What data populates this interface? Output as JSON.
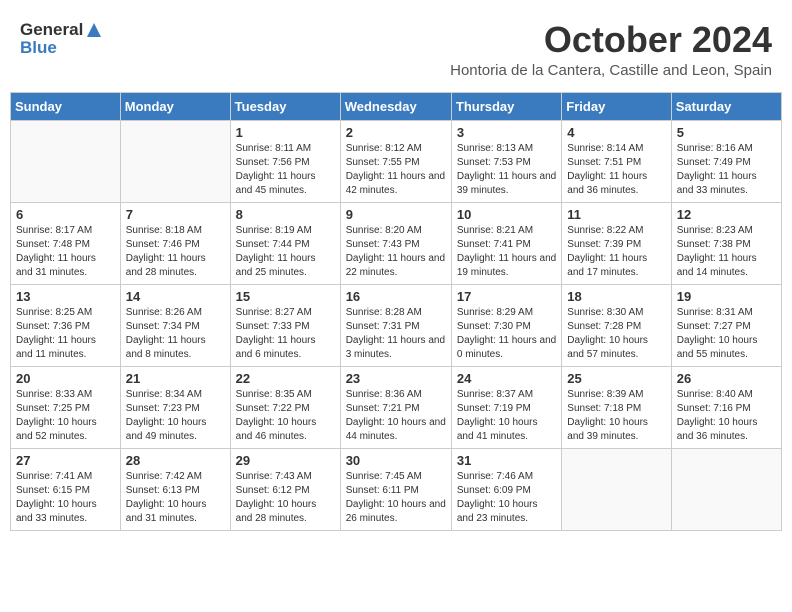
{
  "logo": {
    "general": "General",
    "blue": "Blue"
  },
  "title": "October 2024",
  "location": "Hontoria de la Cantera, Castille and Leon, Spain",
  "weekdays": [
    "Sunday",
    "Monday",
    "Tuesday",
    "Wednesday",
    "Thursday",
    "Friday",
    "Saturday"
  ],
  "weeks": [
    [
      {
        "day": "",
        "info": ""
      },
      {
        "day": "",
        "info": ""
      },
      {
        "day": "1",
        "info": "Sunrise: 8:11 AM\nSunset: 7:56 PM\nDaylight: 11 hours and 45 minutes."
      },
      {
        "day": "2",
        "info": "Sunrise: 8:12 AM\nSunset: 7:55 PM\nDaylight: 11 hours and 42 minutes."
      },
      {
        "day": "3",
        "info": "Sunrise: 8:13 AM\nSunset: 7:53 PM\nDaylight: 11 hours and 39 minutes."
      },
      {
        "day": "4",
        "info": "Sunrise: 8:14 AM\nSunset: 7:51 PM\nDaylight: 11 hours and 36 minutes."
      },
      {
        "day": "5",
        "info": "Sunrise: 8:16 AM\nSunset: 7:49 PM\nDaylight: 11 hours and 33 minutes."
      }
    ],
    [
      {
        "day": "6",
        "info": "Sunrise: 8:17 AM\nSunset: 7:48 PM\nDaylight: 11 hours and 31 minutes."
      },
      {
        "day": "7",
        "info": "Sunrise: 8:18 AM\nSunset: 7:46 PM\nDaylight: 11 hours and 28 minutes."
      },
      {
        "day": "8",
        "info": "Sunrise: 8:19 AM\nSunset: 7:44 PM\nDaylight: 11 hours and 25 minutes."
      },
      {
        "day": "9",
        "info": "Sunrise: 8:20 AM\nSunset: 7:43 PM\nDaylight: 11 hours and 22 minutes."
      },
      {
        "day": "10",
        "info": "Sunrise: 8:21 AM\nSunset: 7:41 PM\nDaylight: 11 hours and 19 minutes."
      },
      {
        "day": "11",
        "info": "Sunrise: 8:22 AM\nSunset: 7:39 PM\nDaylight: 11 hours and 17 minutes."
      },
      {
        "day": "12",
        "info": "Sunrise: 8:23 AM\nSunset: 7:38 PM\nDaylight: 11 hours and 14 minutes."
      }
    ],
    [
      {
        "day": "13",
        "info": "Sunrise: 8:25 AM\nSunset: 7:36 PM\nDaylight: 11 hours and 11 minutes."
      },
      {
        "day": "14",
        "info": "Sunrise: 8:26 AM\nSunset: 7:34 PM\nDaylight: 11 hours and 8 minutes."
      },
      {
        "day": "15",
        "info": "Sunrise: 8:27 AM\nSunset: 7:33 PM\nDaylight: 11 hours and 6 minutes."
      },
      {
        "day": "16",
        "info": "Sunrise: 8:28 AM\nSunset: 7:31 PM\nDaylight: 11 hours and 3 minutes."
      },
      {
        "day": "17",
        "info": "Sunrise: 8:29 AM\nSunset: 7:30 PM\nDaylight: 11 hours and 0 minutes."
      },
      {
        "day": "18",
        "info": "Sunrise: 8:30 AM\nSunset: 7:28 PM\nDaylight: 10 hours and 57 minutes."
      },
      {
        "day": "19",
        "info": "Sunrise: 8:31 AM\nSunset: 7:27 PM\nDaylight: 10 hours and 55 minutes."
      }
    ],
    [
      {
        "day": "20",
        "info": "Sunrise: 8:33 AM\nSunset: 7:25 PM\nDaylight: 10 hours and 52 minutes."
      },
      {
        "day": "21",
        "info": "Sunrise: 8:34 AM\nSunset: 7:23 PM\nDaylight: 10 hours and 49 minutes."
      },
      {
        "day": "22",
        "info": "Sunrise: 8:35 AM\nSunset: 7:22 PM\nDaylight: 10 hours and 46 minutes."
      },
      {
        "day": "23",
        "info": "Sunrise: 8:36 AM\nSunset: 7:21 PM\nDaylight: 10 hours and 44 minutes."
      },
      {
        "day": "24",
        "info": "Sunrise: 8:37 AM\nSunset: 7:19 PM\nDaylight: 10 hours and 41 minutes."
      },
      {
        "day": "25",
        "info": "Sunrise: 8:39 AM\nSunset: 7:18 PM\nDaylight: 10 hours and 39 minutes."
      },
      {
        "day": "26",
        "info": "Sunrise: 8:40 AM\nSunset: 7:16 PM\nDaylight: 10 hours and 36 minutes."
      }
    ],
    [
      {
        "day": "27",
        "info": "Sunrise: 7:41 AM\nSunset: 6:15 PM\nDaylight: 10 hours and 33 minutes."
      },
      {
        "day": "28",
        "info": "Sunrise: 7:42 AM\nSunset: 6:13 PM\nDaylight: 10 hours and 31 minutes."
      },
      {
        "day": "29",
        "info": "Sunrise: 7:43 AM\nSunset: 6:12 PM\nDaylight: 10 hours and 28 minutes."
      },
      {
        "day": "30",
        "info": "Sunrise: 7:45 AM\nSunset: 6:11 PM\nDaylight: 10 hours and 26 minutes."
      },
      {
        "day": "31",
        "info": "Sunrise: 7:46 AM\nSunset: 6:09 PM\nDaylight: 10 hours and 23 minutes."
      },
      {
        "day": "",
        "info": ""
      },
      {
        "day": "",
        "info": ""
      }
    ]
  ]
}
